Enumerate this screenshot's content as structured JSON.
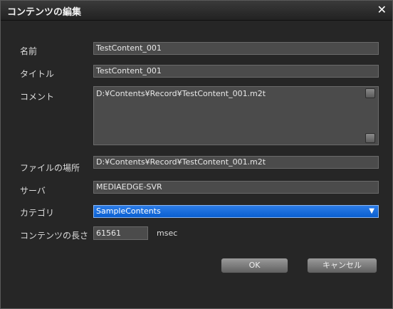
{
  "window": {
    "title": "コンテンツの編集",
    "close_glyph": "✕"
  },
  "form": {
    "name": {
      "label": "名前",
      "value": "TestContent_001"
    },
    "title": {
      "label": "タイトル",
      "value": "TestContent_001"
    },
    "comment": {
      "label": "コメント",
      "value": "D:¥Contents¥Record¥TestContent_001.m2t"
    },
    "file_path": {
      "label": "ファイルの場所",
      "value": "D:¥Contents¥Record¥TestContent_001.m2t"
    },
    "server": {
      "label": "サーバ",
      "value": "MEDIAEDGE-SVR"
    },
    "category": {
      "label": "カテゴリ",
      "value": "SampleContents"
    },
    "duration": {
      "label": "コンテンツの長さ",
      "value": "61561",
      "unit": "msec"
    }
  },
  "buttons": {
    "ok": "OK",
    "cancel": "キャンセル"
  },
  "colors": {
    "dialog_bg": "#262626",
    "field_bg": "#4b4b4b",
    "select_accent": "#1a6fdc"
  },
  "icons": {
    "close": "close-icon",
    "dropdown": "chevron-down-icon",
    "scroll_up": "scroll-up-icon",
    "scroll_down": "scroll-down-icon"
  }
}
